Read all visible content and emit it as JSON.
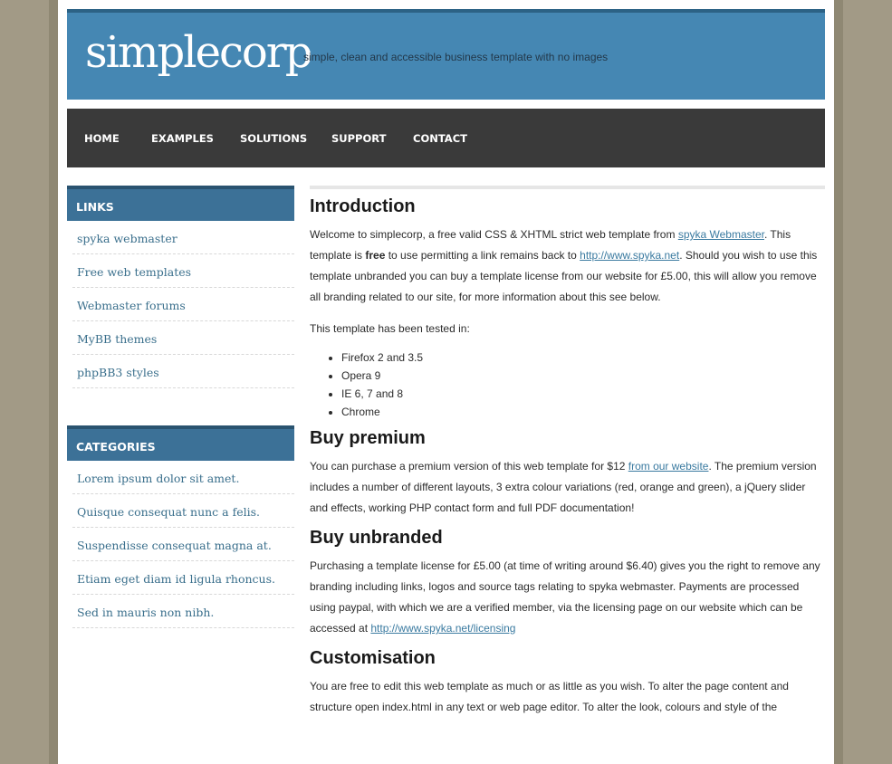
{
  "header": {
    "logo": "simplecorp",
    "tagline": "simple, clean and accessible business template with no images"
  },
  "nav": [
    "HOME",
    "EXAMPLES",
    "SOLUTIONS",
    "SUPPORT",
    "CONTACT"
  ],
  "sidebar": {
    "links": {
      "title": "LINKS",
      "items": [
        "spyka webmaster",
        "Free web templates",
        "Webmaster forums",
        "MyBB themes",
        "phpBB3 styles"
      ]
    },
    "categories": {
      "title": "CATEGORIES",
      "items": [
        "Lorem ipsum dolor sit amet.",
        "Quisque consequat nunc a felis.",
        "Suspendisse consequat magna at.",
        "Etiam eget diam id ligula rhoncus.",
        "Sed in mauris non nibh."
      ]
    }
  },
  "content": {
    "intro": {
      "title": "Introduction",
      "p1_a": "Welcome to simplecorp, a free valid CSS & XHTML strict web template from ",
      "p1_link1": "spyka Webmaster",
      "p1_b": ". This template is ",
      "p1_bold": "free",
      "p1_c": " to use permitting a link remains back to ",
      "p1_link2": "http://www.spyka.net",
      "p1_d": ". Should you wish to use this template unbranded you can buy a template license from our website for £5.00, this will allow you remove all branding related to our site, for more information about this see below.",
      "p2": "This template has been tested in:",
      "browsers": [
        "Firefox 2 and 3.5",
        "Opera 9",
        "IE 6, 7 and 8",
        "Chrome"
      ]
    },
    "premium": {
      "title": "Buy premium",
      "p_a": "You can purchase a premium version of this web template for $12 ",
      "p_link": "from our website",
      "p_b": ". The premium version includes a number of different layouts, 3 extra colour variations (red, orange and green), a jQuery slider and effects, working PHP contact form and full PDF documentation!"
    },
    "unbranded": {
      "title": "Buy unbranded",
      "p_a": "Purchasing a template license for £5.00 (at time of writing around $6.40) gives you the right to remove any branding including links, logos and source tags relating to spyka webmaster. Payments are processed using paypal, with which we are a verified member, via the licensing page on our website which can be accessed at ",
      "p_link": "http://www.spyka.net/licensing"
    },
    "custom": {
      "title": "Customisation",
      "p": "You are free to edit this web template as much or as little as you wish. To alter the page content and structure open index.html in any text or web page editor. To alter the look, colours and style of the"
    }
  }
}
